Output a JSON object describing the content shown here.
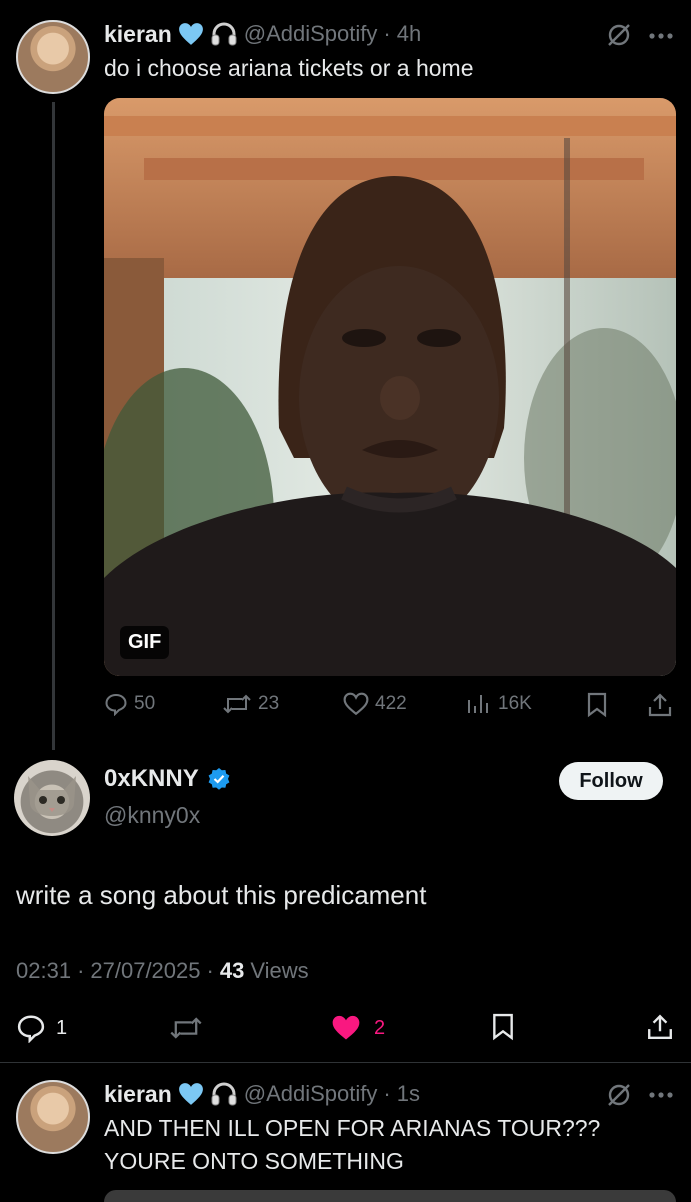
{
  "parent_tweet": {
    "display_name": "kieran",
    "handle": "@AddiSpotify",
    "separator": "·",
    "time": "4h",
    "text": "do i choose ariana tickets or a home",
    "media_badge": "GIF",
    "replies": "50",
    "reposts": "23",
    "likes": "422",
    "views": "16K"
  },
  "main_tweet": {
    "display_name": "0xKNNY",
    "handle": "@knny0x",
    "follow_label": "Follow",
    "text": "write a song about this predicament",
    "time": "02:31",
    "sep1": "·",
    "date": "27/07/2025",
    "sep2": "·",
    "views_count": "43",
    "views_label": "Views",
    "replies": "1",
    "likes": "2"
  },
  "reply_tweet": {
    "display_name": "kieran",
    "handle": "@AddiSpotify",
    "separator": "·",
    "time": "1s",
    "text_line1": "AND THEN ILL OPEN FOR ARIANAS TOUR???",
    "text_line2": "YOURE ONTO SOMETHING"
  },
  "colors": {
    "background": "#000000",
    "text": "#e7e9ea",
    "secondary": "#71767b",
    "verified_blue": "#1d9bf0",
    "like_pink": "#f91880",
    "heart_emoji": "#7cc8f4"
  },
  "icons": [
    "reply-icon",
    "repost-icon",
    "like-icon",
    "views-icon",
    "bookmark-icon",
    "share-icon",
    "more-icon",
    "grok-icon",
    "verified-badge-icon",
    "heart-emoji-icon",
    "headphones-emoji-icon"
  ]
}
